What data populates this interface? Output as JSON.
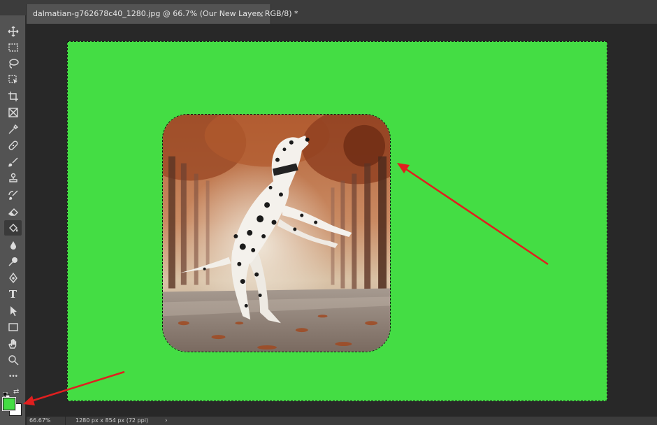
{
  "app": {
    "document_tab_title": "dalmatian-g762678c40_1280.jpg @ 66.7% (Our New Layer, RGB/8) *",
    "tab_close_glyph": "×",
    "toolbar_collapse_glyph": "››"
  },
  "toolbar": {
    "tools": [
      {
        "name": "move-tool",
        "icon": "move-icon"
      },
      {
        "name": "rectangular-marquee-tool",
        "icon": "marquee-icon"
      },
      {
        "name": "lasso-tool",
        "icon": "lasso-icon"
      },
      {
        "name": "object-selection-tool",
        "icon": "object-selection-icon"
      },
      {
        "name": "crop-tool",
        "icon": "crop-icon"
      },
      {
        "name": "frame-tool",
        "icon": "frame-icon"
      },
      {
        "name": "eyedropper-tool",
        "icon": "eyedropper-icon"
      },
      {
        "name": "healing-brush-tool",
        "icon": "bandage-icon"
      },
      {
        "name": "brush-tool",
        "icon": "brush-icon"
      },
      {
        "name": "clone-stamp-tool",
        "icon": "stamp-icon"
      },
      {
        "name": "history-brush-tool",
        "icon": "history-brush-icon"
      },
      {
        "name": "eraser-tool",
        "icon": "eraser-icon"
      },
      {
        "name": "paint-bucket-tool",
        "icon": "paint-bucket-icon",
        "active": true
      },
      {
        "name": "blur-tool",
        "icon": "drop-icon"
      },
      {
        "name": "dodge-tool",
        "icon": "dodge-icon"
      },
      {
        "name": "pen-tool",
        "icon": "pen-icon"
      },
      {
        "name": "type-tool",
        "icon": "type-icon"
      },
      {
        "name": "path-selection-tool",
        "icon": "arrow-pointer-icon"
      },
      {
        "name": "rectangle-tool",
        "icon": "rectangle-icon"
      },
      {
        "name": "hand-tool",
        "icon": "hand-icon"
      },
      {
        "name": "zoom-tool",
        "icon": "magnifier-icon"
      },
      {
        "name": "edit-toolbar",
        "icon": "ellipsis-icon"
      }
    ],
    "type_glyph": "T",
    "ellipsis_glyph": "•••",
    "swap_glyph": "⇄"
  },
  "colors": {
    "foreground": "#44dd44",
    "background": "#ffffff",
    "canvas_fill": "#44dd44",
    "annotation_arrow": "#e01f1f"
  },
  "status": {
    "zoom": "66.67%",
    "document_info": "1280 px x 854 px (72 ppi)",
    "menu_arrow": "›"
  }
}
